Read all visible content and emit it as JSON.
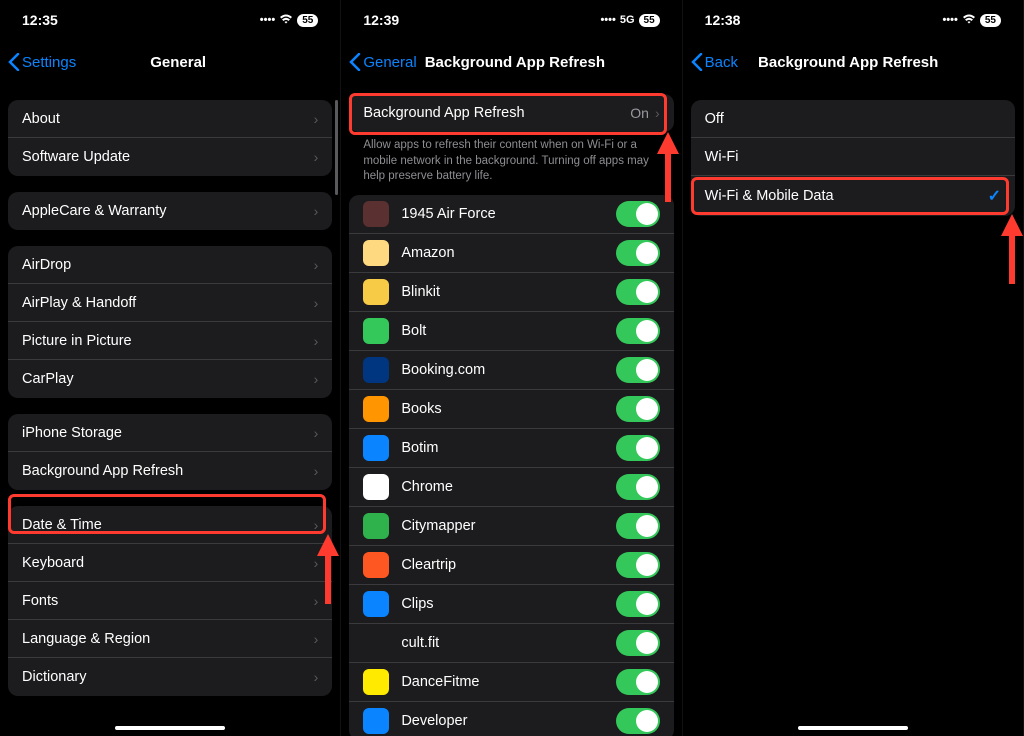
{
  "screen1": {
    "time": "12:35",
    "battery": "55",
    "back": "Settings",
    "title": "General",
    "group1": [
      "About",
      "Software Update"
    ],
    "group2": [
      "AppleCare & Warranty"
    ],
    "group3": [
      "AirDrop",
      "AirPlay & Handoff",
      "Picture in Picture",
      "CarPlay"
    ],
    "group4": [
      "iPhone Storage",
      "Background App Refresh"
    ],
    "group5": [
      "Date & Time",
      "Keyboard",
      "Fonts",
      "Language & Region",
      "Dictionary"
    ]
  },
  "screen2": {
    "time": "12:39",
    "signal": "5G",
    "battery": "55",
    "back": "General",
    "title": "Background App Refresh",
    "master_label": "Background App Refresh",
    "master_value": "On",
    "footer": "Allow apps to refresh their content when on Wi-Fi or a mobile network in the background. Turning off apps may help preserve battery life.",
    "apps": [
      {
        "name": "1945 Air Force",
        "bg": "#5a3030"
      },
      {
        "name": "Amazon",
        "bg": "#ffd980"
      },
      {
        "name": "Blinkit",
        "bg": "#f8cb46"
      },
      {
        "name": "Bolt",
        "bg": "#34c759"
      },
      {
        "name": "Booking.com",
        "bg": "#003580"
      },
      {
        "name": "Books",
        "bg": "#ff9500"
      },
      {
        "name": "Botim",
        "bg": "#0a84ff"
      },
      {
        "name": "Chrome",
        "bg": "#ffffff"
      },
      {
        "name": "Citymapper",
        "bg": "#2fb24c"
      },
      {
        "name": "Cleartrip",
        "bg": "#ff5722"
      },
      {
        "name": "Clips",
        "bg": "#0a84ff"
      },
      {
        "name": "cult.fit",
        "bg": "#1c1c1e"
      },
      {
        "name": "DanceFitme",
        "bg": "#ffea00"
      },
      {
        "name": "Developer",
        "bg": "#0a84ff"
      }
    ]
  },
  "screen3": {
    "time": "12:38",
    "battery": "55",
    "back": "Back",
    "title": "Background App Refresh",
    "options": [
      "Off",
      "Wi-Fi",
      "Wi-Fi & Mobile Data"
    ],
    "selected": 2
  }
}
